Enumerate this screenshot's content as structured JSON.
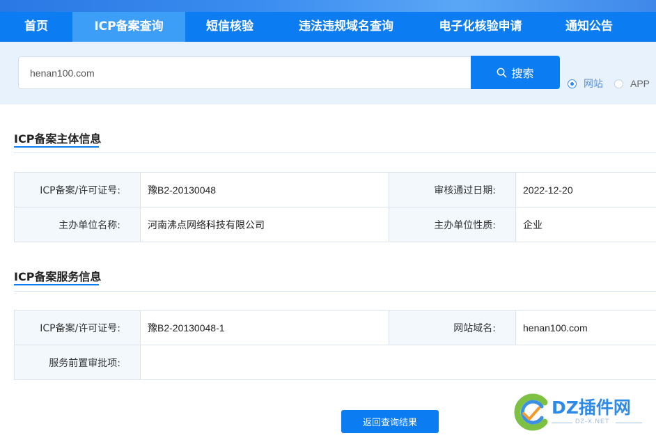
{
  "nav": {
    "items": [
      {
        "label": "首页"
      },
      {
        "label": "ICP备案查询"
      },
      {
        "label": "短信核验"
      },
      {
        "label": "违法违规域名查询"
      },
      {
        "label": "电子化核验申请"
      },
      {
        "label": "通知公告"
      }
    ],
    "active_index": 1
  },
  "search": {
    "value": "henan100.com",
    "button_label": "搜索",
    "button_icon": "search-icon",
    "types": [
      {
        "label": "网站",
        "selected": true
      },
      {
        "label": "APP",
        "selected": false
      }
    ]
  },
  "entity_section": {
    "title": "ICP备案主体信息",
    "rows": [
      {
        "label1": "ICP备案/许可证号:",
        "value1": "豫B2-20130048",
        "label2": "审核通过日期:",
        "value2": "2022-12-20"
      },
      {
        "label1": "主办单位名称:",
        "value1": "河南沸点网络科技有限公司",
        "label2": "主办单位性质:",
        "value2": "企业"
      }
    ]
  },
  "service_section": {
    "title": "ICP备案服务信息",
    "rows": [
      {
        "label1": "ICP备案/许可证号:",
        "value1": "豫B2-20130048-1",
        "label2": "网站域名:",
        "value2": "henan100.com"
      },
      {
        "label1": "服务前置审批项:",
        "value1": ""
      }
    ]
  },
  "back_button_label": "返回查询结果",
  "watermark": {
    "text": "DZ插件网",
    "sub": "DZ-X.NET"
  },
  "colors": {
    "primary": "#0b7cf1",
    "nav_active": "#3d9ef7",
    "search_band": "#e8f2fd",
    "label_bg": "#f3f8fd"
  }
}
